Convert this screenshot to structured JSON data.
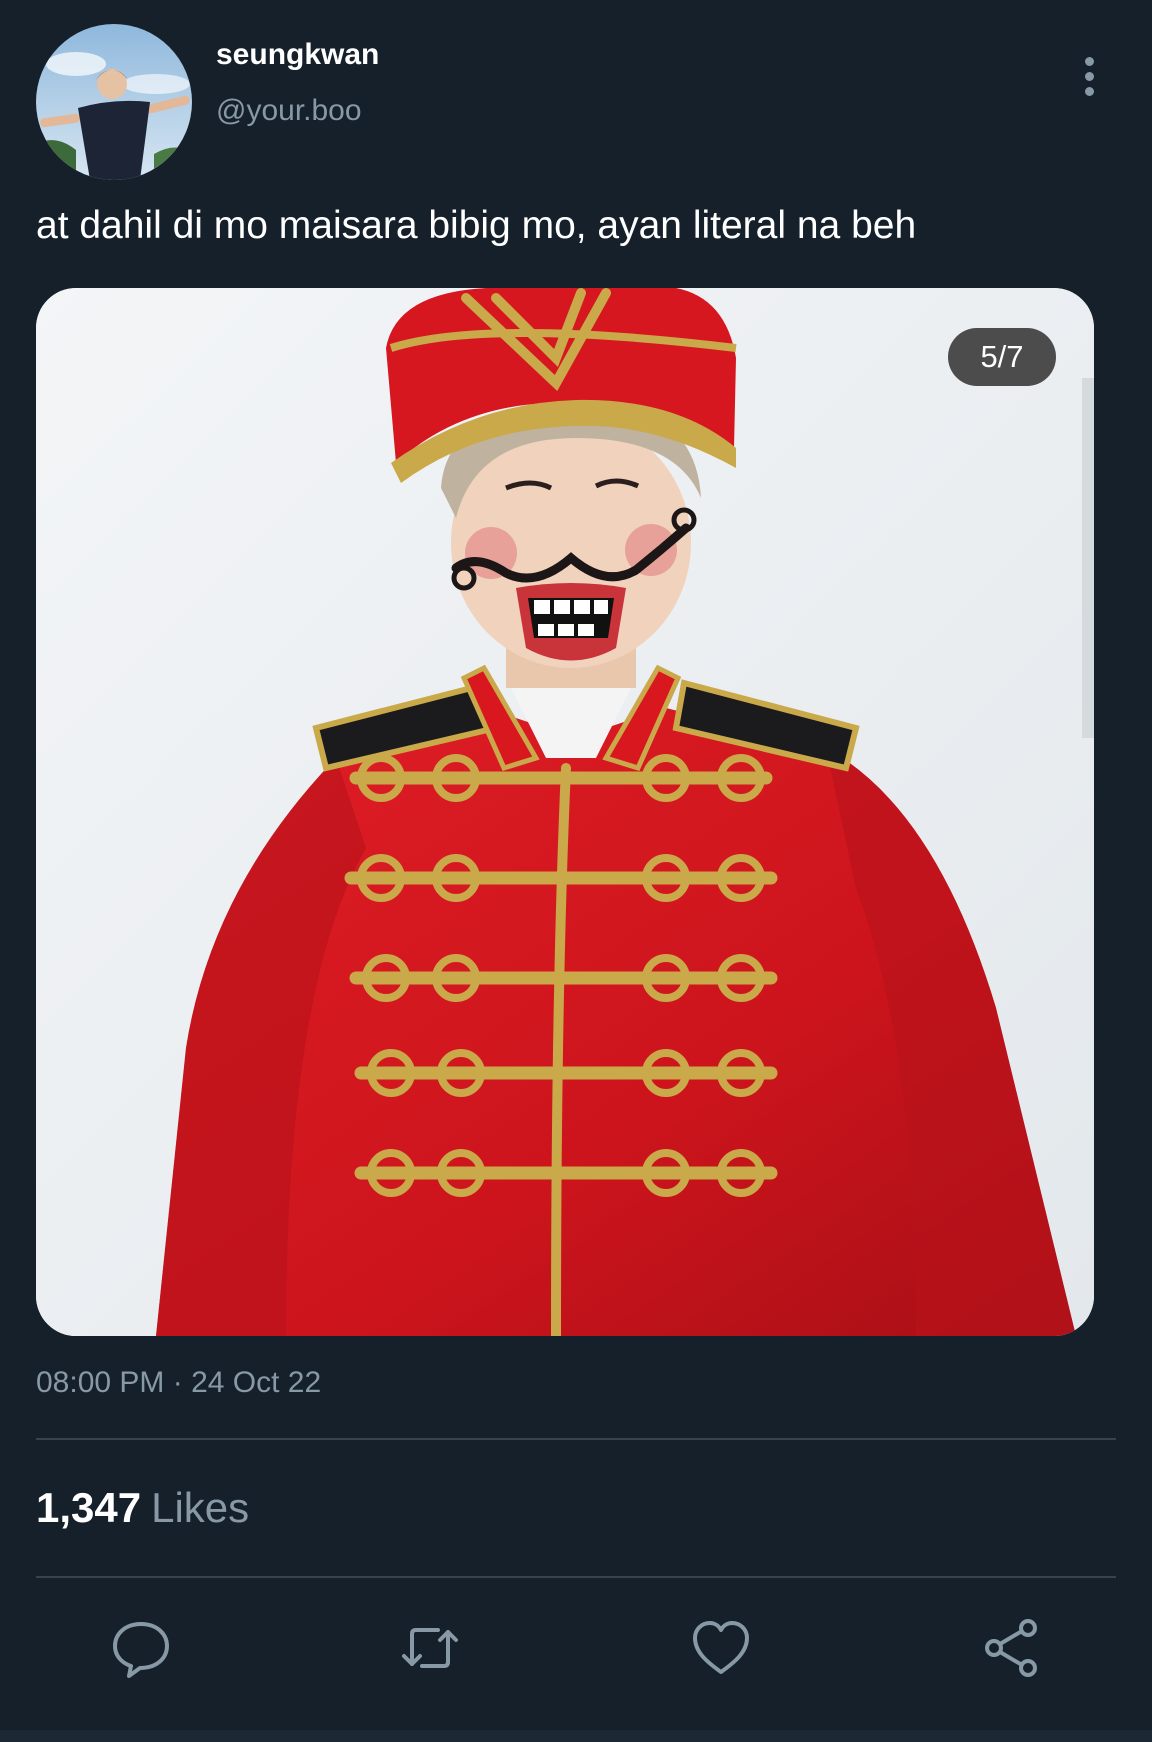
{
  "user": {
    "display_name": "seungkwan",
    "handle": "@your.boo"
  },
  "tweet": {
    "text": "at dahil di mo maisara bibig mo, ayan literal na beh",
    "timestamp": "08:00 PM · 24 Oct 22",
    "media_counter": "5/7"
  },
  "stats": {
    "likes_count": "1,347",
    "likes_label": "Likes"
  },
  "actions": {
    "reply_icon": "reply-icon",
    "retweet_icon": "retweet-icon",
    "like_icon": "heart-icon",
    "share_icon": "share-icon"
  },
  "colors": {
    "background": "#15202b",
    "secondary_text": "#8899a6",
    "divider": "#38444d",
    "jacket_red": "#d8171f",
    "braid_gold": "#c9a94a"
  }
}
